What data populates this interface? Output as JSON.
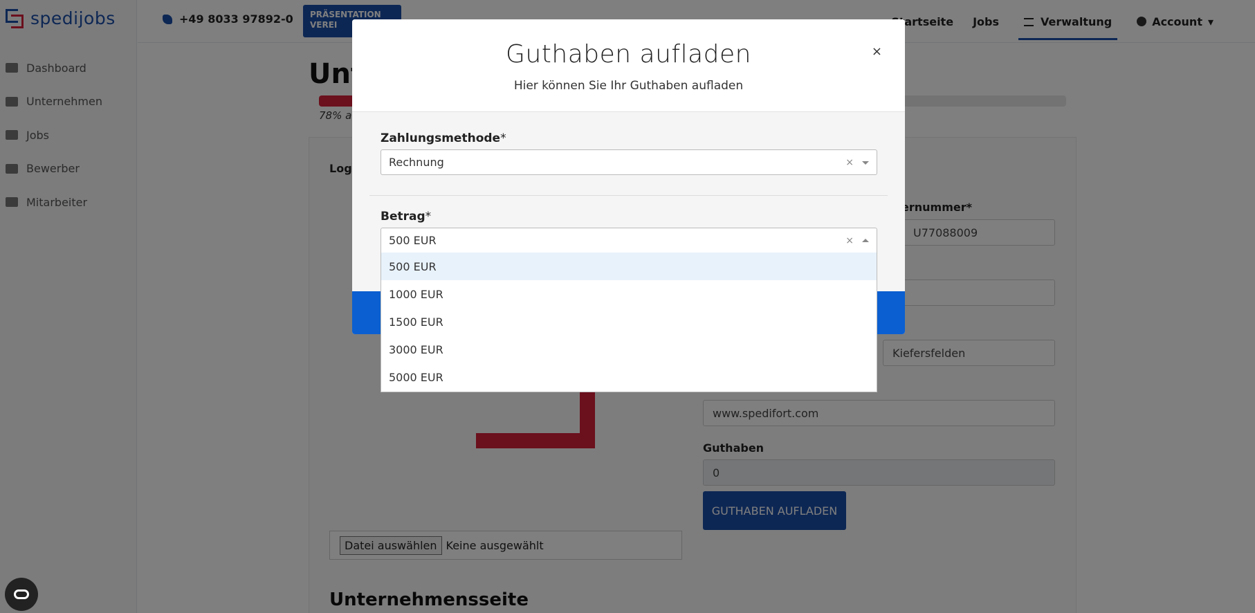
{
  "brand": {
    "name": "spedijobs"
  },
  "sidebar": {
    "items": [
      {
        "label": "Dashboard",
        "icon": "dashboard-icon"
      },
      {
        "label": "Unternehmen",
        "icon": "building-icon"
      },
      {
        "label": "Jobs",
        "icon": "briefcase-icon"
      },
      {
        "label": "Bewerber",
        "icon": "user-cog-icon"
      },
      {
        "label": "Mitarbeiter",
        "icon": "users-icon"
      }
    ]
  },
  "topbar": {
    "phone": "+49 8033 97892-0",
    "praesentation_label": "PRÄSENTATION VEREI",
    "nav": {
      "startseite": "Startseite",
      "jobs": "Jobs",
      "verwaltung": "Verwaltung",
      "account": "Account"
    }
  },
  "page": {
    "title": "Unt",
    "progress_percent": 78,
    "progress_text": "78% a",
    "logo_label": "Logo",
    "file_button": "Datei auswählen",
    "file_status": "Keine ausgewählt",
    "section_title": "Unternehmensseite",
    "fields": {
      "id_label": "ernummer*",
      "id_value": "U77088009",
      "city_value": "Kiefersfelden",
      "homepage_value": "www.spedifort.com",
      "guthaben_label": "Guthaben",
      "guthaben_value": "0"
    },
    "guthaben_button": "GUTHABEN AUFLADEN"
  },
  "modal": {
    "title": "Guthaben aufladen",
    "subtitle": "Hier können Sie Ihr Guthaben aufladen",
    "close": "×",
    "payment_label": "Zahlungsmethode",
    "payment_value": "Rechnung",
    "amount_label": "Betrag",
    "amount_value": "500 EUR",
    "required_mark": "*",
    "clear": "×",
    "amount_options": [
      "500 EUR",
      "1000 EUR",
      "1500 EUR",
      "3000 EUR",
      "5000 EUR"
    ],
    "highlighted_option": "500 EUR"
  },
  "colors": {
    "brand_blue": "#1b4fa8",
    "brand_red": "#d6213a",
    "footer_blue": "#0b5fd0",
    "highlight": "#e8f2fb"
  }
}
